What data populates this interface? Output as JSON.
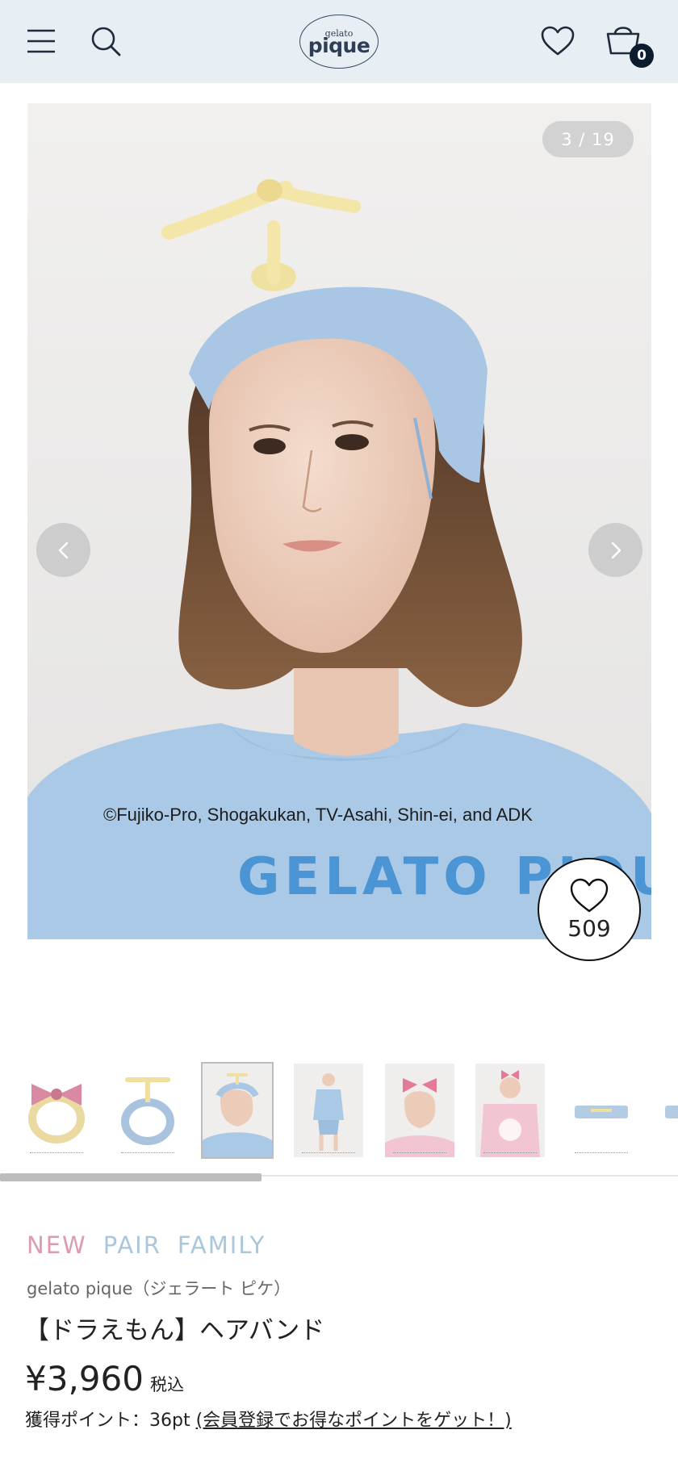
{
  "header": {
    "logo_small": "gelato",
    "logo_big": "pique",
    "cart_count": "0",
    "icons": [
      "menu-icon",
      "search-icon",
      "heart-icon",
      "cart-icon"
    ],
    "background": "#e7eef4"
  },
  "gallery": {
    "counter": "3 / 19",
    "copyright": "©Fujiko-Pro, Shogakukan, TV-Asahi, Shin-ei, and ADK",
    "shirt_text": "GELATO PIQUE",
    "like_count": "509"
  },
  "thumbnails": [
    {
      "name": "pink-bow-headband"
    },
    {
      "name": "propeller-headband"
    },
    {
      "name": "model-propeller-headband",
      "active": true
    },
    {
      "name": "model-full-outfit"
    },
    {
      "name": "model-pink-bow"
    },
    {
      "name": "model-pink-outfit"
    },
    {
      "name": "headband-flat"
    },
    {
      "name": "headband-flat-2"
    }
  ],
  "product": {
    "tags": {
      "new": "NEW",
      "pair": "PAIR",
      "family": "FAMILY"
    },
    "brand": "gelato pique（ジェラート ピケ）",
    "title": "【ドラえもん】ヘアバンド",
    "price": "¥3,960",
    "tax_label": "税込",
    "points_prefix": "獲得ポイント：36pt ",
    "points_link": "(会員登録でお得なポイントをゲット！)"
  },
  "colors": {
    "tag_new": "#dc9bb0",
    "tag_other": "#a9c7db",
    "accent_dark": "#0d1b2e"
  }
}
